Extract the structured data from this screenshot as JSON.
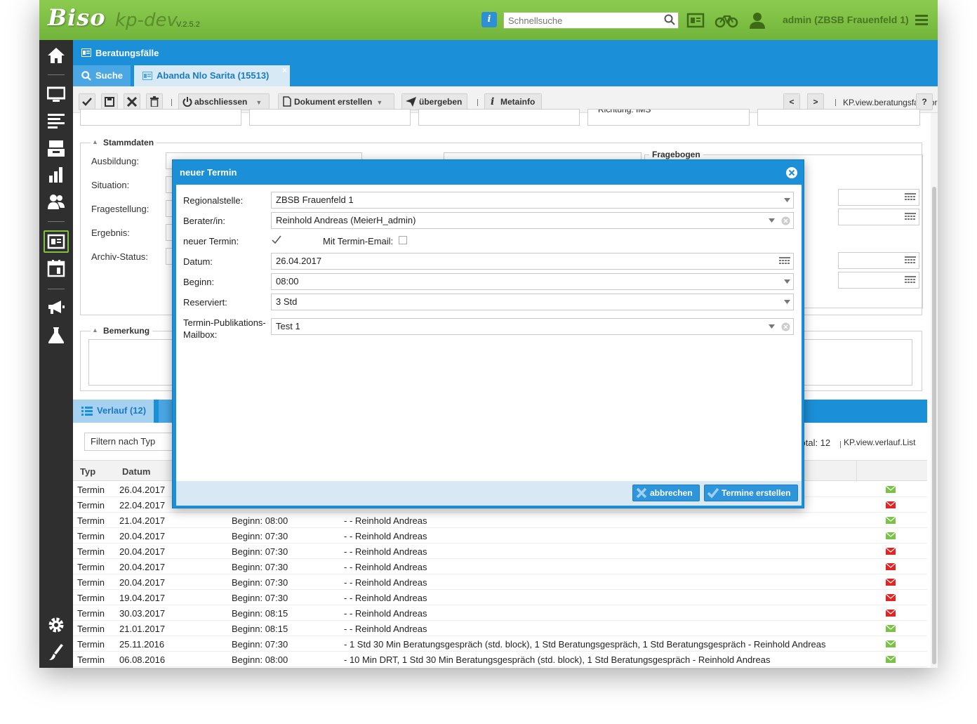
{
  "app": {
    "logo": "Biso",
    "name": "kp-dev",
    "version": "V.2.5.2",
    "search_placeholder": "Schnellsuche",
    "user": "admin (ZBSB Frauenfeld 1)"
  },
  "module": {
    "title": "Beratungsfälle",
    "tabs": [
      {
        "label": "Suche"
      },
      {
        "label": "Abanda Nlo Sarita (15513)"
      }
    ]
  },
  "toolbar": {
    "abschliessen": "abschliessen",
    "dokument": "Dokument erstellen",
    "uebergeben": "übergeben",
    "metainfo": "Metainfo",
    "prev": "<",
    "next": ">",
    "view": "KP.view.beratungsfall.Form",
    "help": "?"
  },
  "form": {
    "top_text": "Richtung: IMS",
    "stammdaten": "Stammdaten",
    "fragebogen": "Fragebogen",
    "bemerkung": "Bemerkung",
    "labels": [
      "Ausbildung:",
      "Situation:",
      "Fragestellung:",
      "Ergebnis:",
      "Archiv-Status:"
    ]
  },
  "verlauf": {
    "tab": "Verlauf (12)",
    "filter_placeholder": "Filtern nach Typ",
    "total": "Total: 12",
    "view": "KP.view.verlauf.List",
    "headers": [
      "Typ",
      "Datum"
    ],
    "rows": [
      {
        "typ": "Termin",
        "datum": "26.04.2017",
        "beginn": "",
        "text": "",
        "mail": "green"
      },
      {
        "typ": "Termin",
        "datum": "22.04.2017",
        "beginn": "",
        "text": "",
        "mail": "red"
      },
      {
        "typ": "Termin",
        "datum": "21.04.2017",
        "beginn": "Beginn: 08:00",
        "text": "- - Reinhold Andreas",
        "mail": "green"
      },
      {
        "typ": "Termin",
        "datum": "20.04.2017",
        "beginn": "Beginn: 07:30",
        "text": "- - Reinhold Andreas",
        "mail": "green"
      },
      {
        "typ": "Termin",
        "datum": "20.04.2017",
        "beginn": "Beginn: 07:30",
        "text": "- - Reinhold Andreas",
        "mail": "red"
      },
      {
        "typ": "Termin",
        "datum": "20.04.2017",
        "beginn": "Beginn: 07:30",
        "text": "- - Reinhold Andreas",
        "mail": "red"
      },
      {
        "typ": "Termin",
        "datum": "20.04.2017",
        "beginn": "Beginn: 07:30",
        "text": "- - Reinhold Andreas",
        "mail": "red"
      },
      {
        "typ": "Termin",
        "datum": "19.04.2017",
        "beginn": "Beginn: 07:30",
        "text": "- - Reinhold Andreas",
        "mail": "red"
      },
      {
        "typ": "Termin",
        "datum": "30.03.2017",
        "beginn": "Beginn: 08:15",
        "text": "- - Reinhold Andreas",
        "mail": "red"
      },
      {
        "typ": "Termin",
        "datum": "21.01.2017",
        "beginn": "Beginn: 08:15",
        "text": "- - Reinhold Andreas",
        "mail": "green"
      },
      {
        "typ": "Termin",
        "datum": "25.11.2016",
        "beginn": "Beginn: 07:30",
        "text": "- 1 Std 30 Min Beratungsgespräch (std. block), 1 Std Beratungsgespräch, 1 Std Beratungsgespräch - Reinhold Andreas",
        "mail": "green"
      },
      {
        "typ": "Termin",
        "datum": "06.08.2016",
        "beginn": "Beginn: 08:00",
        "text": "- 10 Min DRT, 1 Std 30 Min Beratungsgespräch (std. block), 1 Std Beratungsgespräch - Reinhold Andreas",
        "mail": "green"
      }
    ]
  },
  "modal": {
    "title": "neuer Termin",
    "regionalstelle_label": "Regionalstelle:",
    "regionalstelle_value": "ZBSB Frauenfeld 1",
    "berater_label": "Berater/in:",
    "berater_value": "Reinhold Andreas (MeierH_admin)",
    "neuer_termin_label": "neuer Termin:",
    "neuer_termin_checked": true,
    "mit_email_label": "Mit Termin-Email:",
    "mit_email_checked": false,
    "datum_label": "Datum:",
    "datum_value": "26.04.2017",
    "beginn_label": "Beginn:",
    "beginn_value": "08:00",
    "reserviert_label": "Reserviert:",
    "reserviert_value": "3 Std",
    "mailbox_label_1": "Termin-Publikations-",
    "mailbox_label_2": "Mailbox:",
    "mailbox_value": "Test 1",
    "cancel": "abbrechen",
    "submit": "Termine erstellen"
  },
  "colors": {
    "green": "#7dc243",
    "blue": "#1b8fd8",
    "mail_green": "#7cc24a",
    "mail_red": "#e02525"
  }
}
